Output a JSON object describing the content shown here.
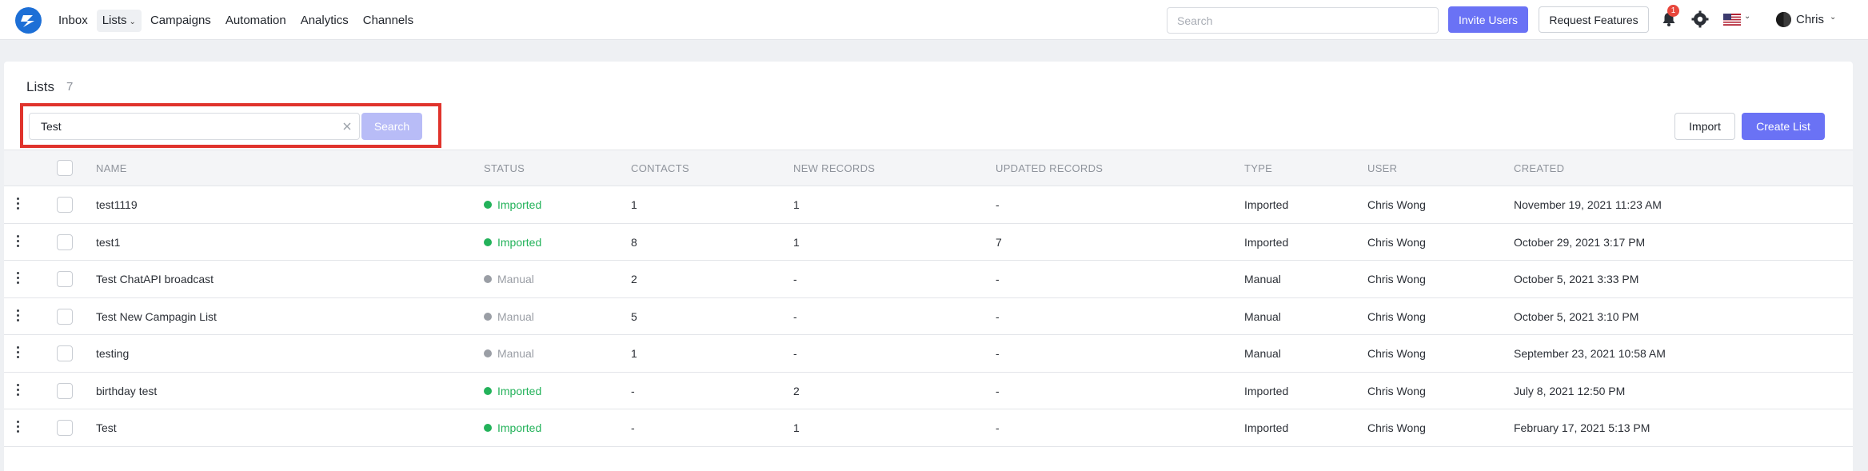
{
  "nav": {
    "items": [
      {
        "label": "Inbox"
      },
      {
        "label": "Lists",
        "active": true,
        "dropdown": true
      },
      {
        "label": "Campaigns"
      },
      {
        "label": "Automation"
      },
      {
        "label": "Analytics"
      },
      {
        "label": "Channels"
      }
    ],
    "search_placeholder": "Search",
    "invite_label": "Invite Users",
    "request_label": "Request Features",
    "notification_count": "1",
    "user_name": "Chris",
    "icons": [
      "logo-icon",
      "bell-icon",
      "gear-icon",
      "us-flag-icon",
      "chevron-down-icon"
    ]
  },
  "lists": {
    "title": "Lists",
    "count": "7",
    "search_value": "Test",
    "search_button": "Search",
    "import_button": "Import",
    "create_button": "Create List",
    "columns": [
      "NAME",
      "STATUS",
      "CONTACTS",
      "NEW RECORDS",
      "UPDATED RECORDS",
      "TYPE",
      "USER",
      "CREATED"
    ],
    "rows": [
      {
        "name": "test1119",
        "status": "Imported",
        "contacts": "1",
        "new_records": "1",
        "updated_records": "-",
        "type": "Imported",
        "user": "Chris Wong",
        "created": "November 19, 2021 11:23 AM"
      },
      {
        "name": "test1",
        "status": "Imported",
        "contacts": "8",
        "new_records": "1",
        "updated_records": "7",
        "type": "Imported",
        "user": "Chris Wong",
        "created": "October 29, 2021 3:17 PM"
      },
      {
        "name": "Test ChatAPI broadcast",
        "status": "Manual",
        "contacts": "2",
        "new_records": "-",
        "updated_records": "-",
        "type": "Manual",
        "user": "Chris Wong",
        "created": "October 5, 2021 3:33 PM"
      },
      {
        "name": "Test New Campagin List",
        "status": "Manual",
        "contacts": "5",
        "new_records": "-",
        "updated_records": "-",
        "type": "Manual",
        "user": "Chris Wong",
        "created": "October 5, 2021 3:10 PM"
      },
      {
        "name": "testing",
        "status": "Manual",
        "contacts": "1",
        "new_records": "-",
        "updated_records": "-",
        "type": "Manual",
        "user": "Chris Wong",
        "created": "September 23, 2021 10:58 AM"
      },
      {
        "name": "birthday test",
        "status": "Imported",
        "contacts": "-",
        "new_records": "2",
        "updated_records": "-",
        "type": "Imported",
        "user": "Chris Wong",
        "created": "July 8, 2021 12:50 PM"
      },
      {
        "name": "Test",
        "status": "Imported",
        "contacts": "-",
        "new_records": "1",
        "updated_records": "-",
        "type": "Imported",
        "user": "Chris Wong",
        "created": "February 17, 2021 5:13 PM"
      }
    ]
  },
  "colors": {
    "accent": "#6a72f5",
    "imported": "#23b25a",
    "manual": "#9a9ea5",
    "highlight": "#e0332c"
  }
}
